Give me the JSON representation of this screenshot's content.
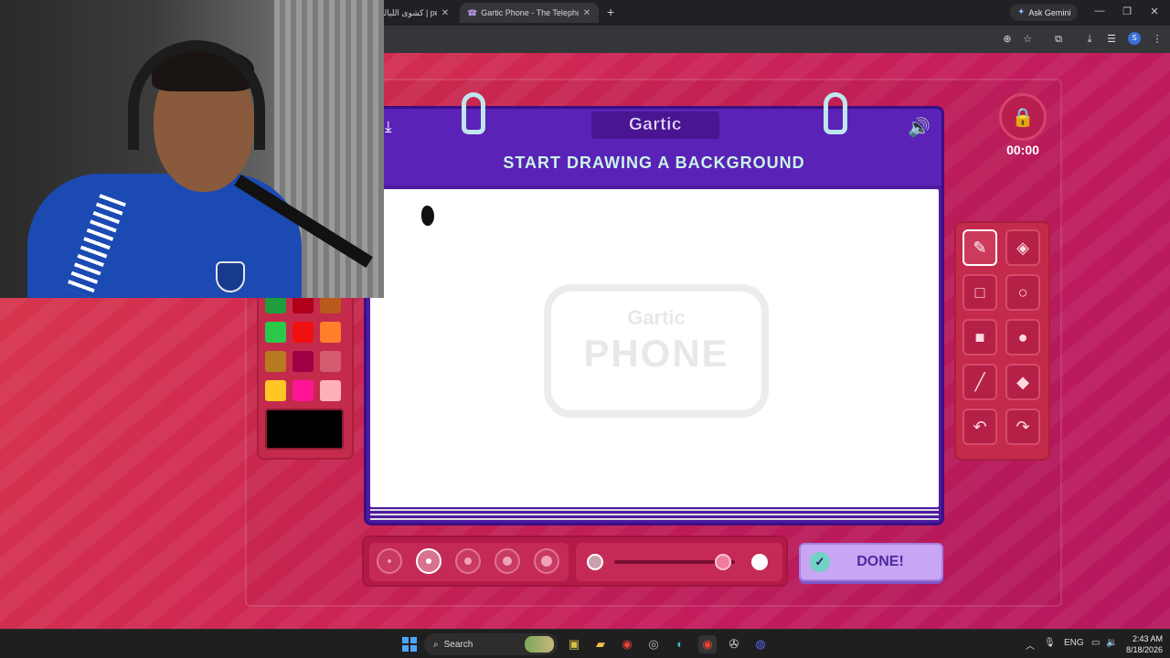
{
  "browser": {
    "tabs": [
      {
        "title": "كشوى الليالي | pe",
        "active": false
      },
      {
        "title": "Gartic Phone - The Telephone G",
        "active": true
      }
    ],
    "new_tab_glyph": "+",
    "ask_gemini": "Ask Gemini",
    "window_controls": [
      "—",
      "❐",
      "✕"
    ],
    "toolbar_icons": [
      "zoom-icon",
      "star-icon",
      "extensions-icon",
      "download-icon",
      "reading-list-icon"
    ],
    "profile_initial": "S"
  },
  "game": {
    "brand": "Gartic",
    "instruction": "START DRAWING A BACKGROUND",
    "timer": "00:00",
    "done_label": "DONE!",
    "watermark_top": "Gartic",
    "watermark_bottom": "PHONE",
    "palette": {
      "colors": [
        "#1f9e3b",
        "#b0001a",
        "#b75a1a",
        "#2ac94a",
        "#ef1010",
        "#ff7f2a",
        "#b87a1e",
        "#9e0045",
        "#d35d6e",
        "#ffc626",
        "#ff1496",
        "#ffb0b8"
      ],
      "current_color": "#000000"
    },
    "tools": [
      {
        "name": "pencil",
        "icon": "✎",
        "selected": true
      },
      {
        "name": "eraser",
        "icon": "◈",
        "selected": false
      },
      {
        "name": "rectangle-outline",
        "icon": "□",
        "selected": false
      },
      {
        "name": "circle-outline",
        "icon": "○",
        "selected": false
      },
      {
        "name": "rectangle-filled",
        "icon": "■",
        "selected": false
      },
      {
        "name": "circle-filled",
        "icon": "●",
        "selected": false
      },
      {
        "name": "line",
        "icon": "╱",
        "selected": false
      },
      {
        "name": "fill-bucket",
        "icon": "◆",
        "selected": false
      },
      {
        "name": "undo",
        "icon": "↶",
        "selected": false
      },
      {
        "name": "redo",
        "icon": "↷",
        "selected": false
      }
    ],
    "brush_sizes": [
      {
        "size": 1,
        "selected": false
      },
      {
        "size": 2,
        "selected": true
      },
      {
        "size": 3,
        "selected": false
      },
      {
        "size": 4,
        "selected": false
      },
      {
        "size": 5,
        "selected": false
      }
    ],
    "opacity_level": 0.9
  },
  "taskbar": {
    "search_label": "Search",
    "tray": {
      "language": "ENG"
    },
    "time": "2:43 AM",
    "date": "8/18/2026"
  }
}
